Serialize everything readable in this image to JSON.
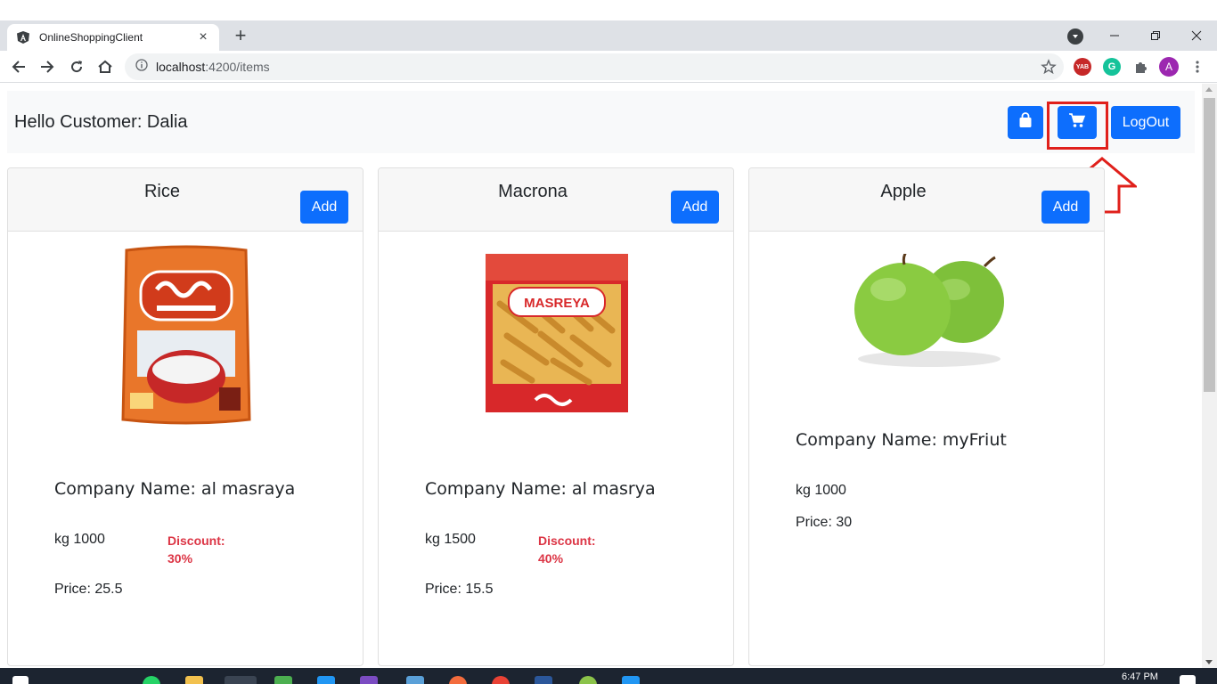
{
  "browser": {
    "tab_title": "OnlineShoppingClient",
    "tab_close": "×",
    "new_tab": "+",
    "url_host": "localhost",
    "url_path": ":4200/items",
    "extensions": [
      "YAB",
      "G",
      "puzzle",
      "A"
    ],
    "profile_initial": "A"
  },
  "header": {
    "greeting": "Hello Customer: Dalia",
    "logout_label": "LogOut"
  },
  "products": [
    {
      "name": "Rice",
      "add_label": "Add",
      "image_label": "rice-package",
      "company": "Company Name: al masraya",
      "weight": "kg 1000",
      "discount_line1": "Discount:",
      "discount_line2": "30%",
      "price": "Price: 25.5"
    },
    {
      "name": "Macrona",
      "add_label": "Add",
      "image_label": "pasta-package",
      "brand": "MASREYA",
      "company": "Company Name: al masrya",
      "weight": "kg 1500",
      "discount_line1": "Discount:",
      "discount_line2": "40%",
      "price": "Price: 15.5"
    },
    {
      "name": "Apple",
      "add_label": "Add",
      "image_label": "green-apples",
      "company": "Company Name: myFriut",
      "weight": "kg 1000",
      "price": "Price: 30"
    }
  ],
  "taskbar": {
    "clock": "6:47 PM"
  },
  "colors": {
    "primary": "#0d6efd",
    "danger": "#dc3545",
    "annotation": "#e0201b"
  }
}
